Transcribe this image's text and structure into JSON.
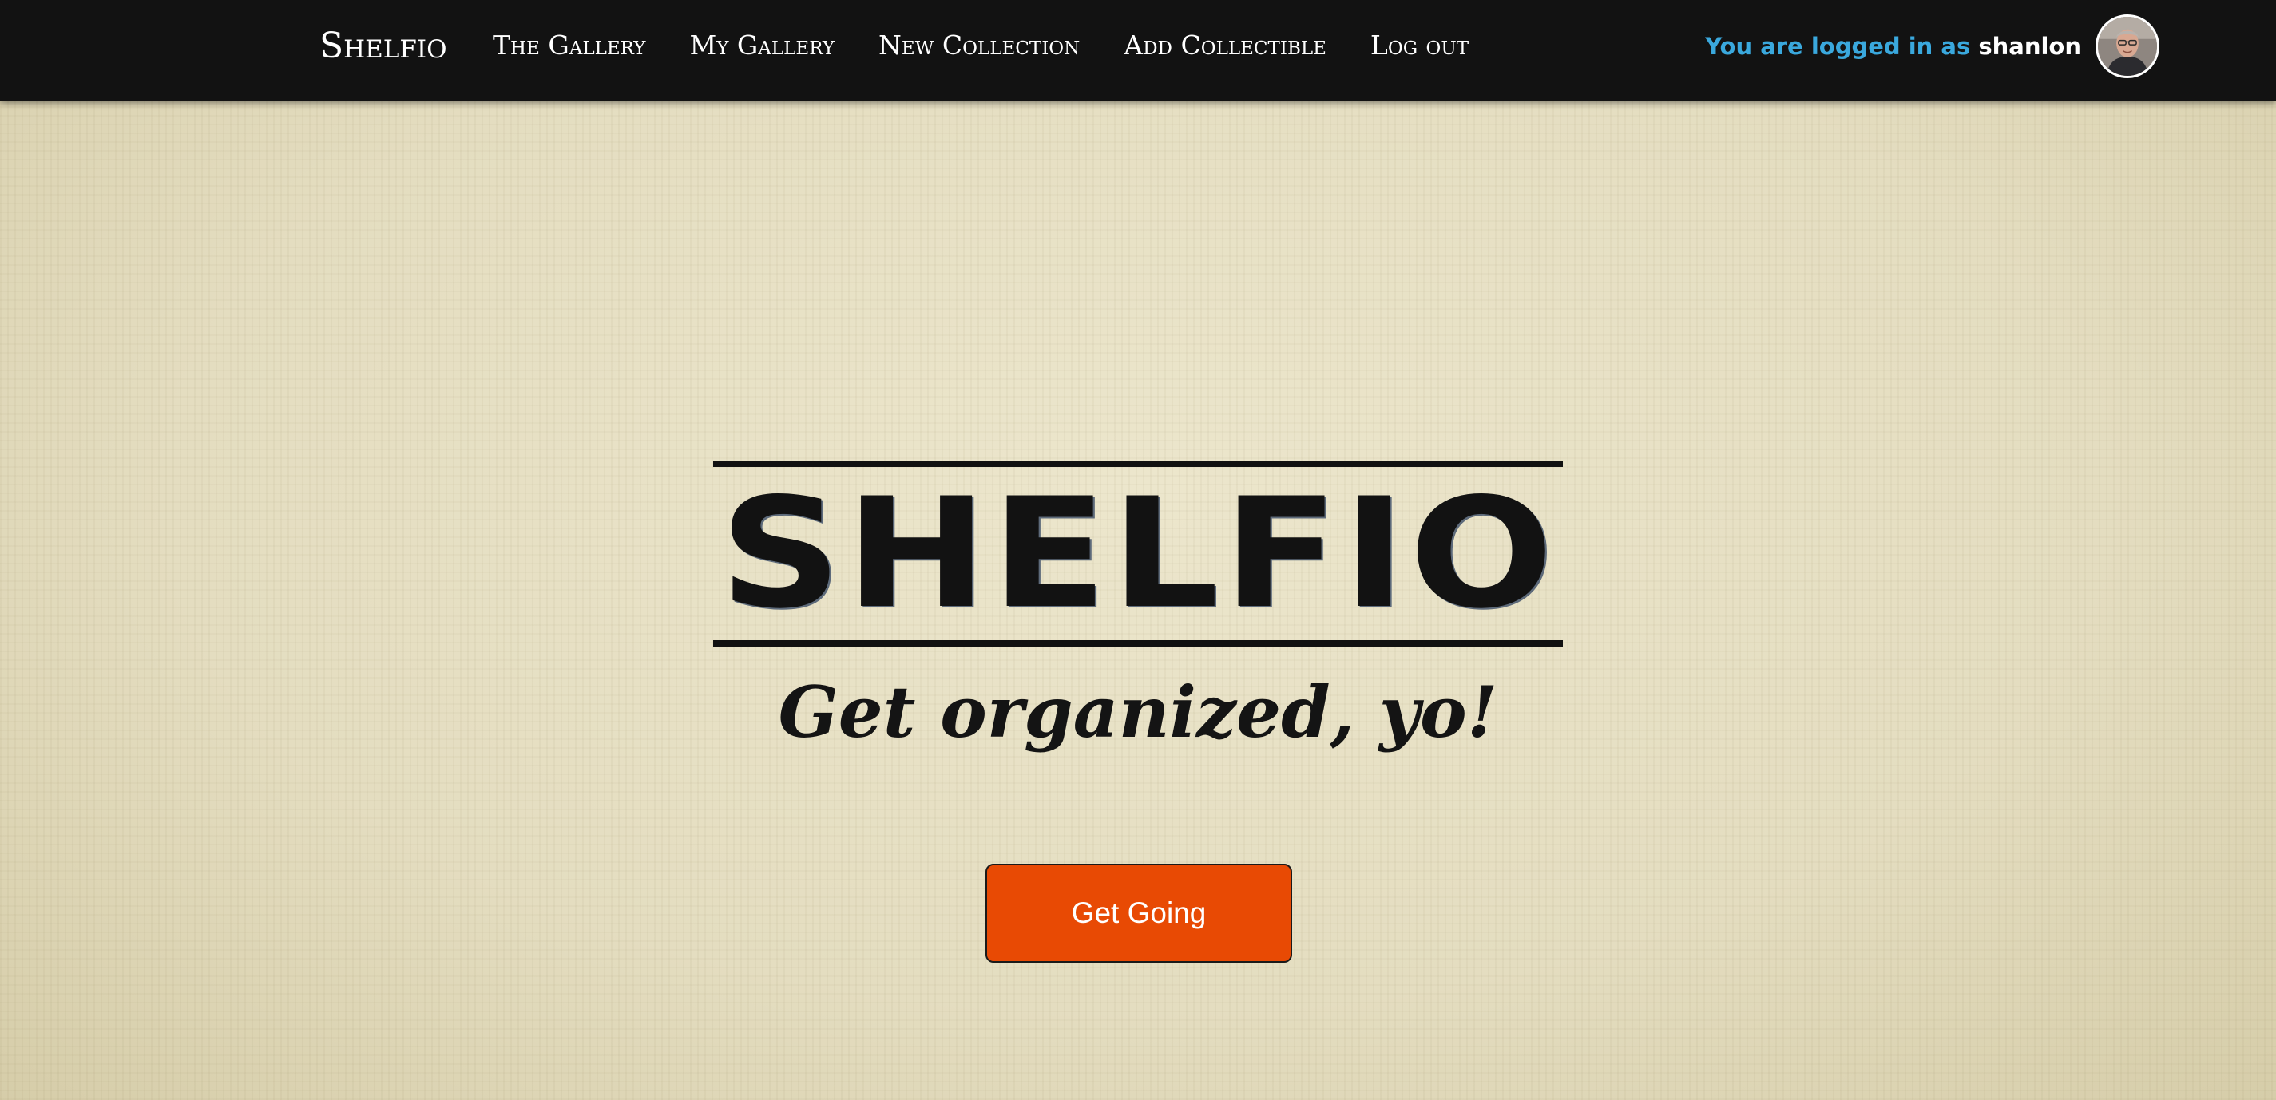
{
  "navbar": {
    "brand": "Shelfio",
    "links": [
      {
        "label": "The Gallery"
      },
      {
        "label": "My Gallery"
      },
      {
        "label": "New Collection"
      },
      {
        "label": "Add Collectible"
      },
      {
        "label": "Log out"
      }
    ],
    "login_prefix": "You are logged in as",
    "username": "shanlon",
    "avatar_icon": "user-avatar-photo"
  },
  "hero": {
    "title": "SHELFIO",
    "tagline": "Get organized, yo!",
    "cta_label": "Get Going"
  },
  "colors": {
    "navbar_bg": "#121212",
    "login_prefix": "#3aa8dd",
    "cta_bg": "#e84a04",
    "page_bg": "#e6dfc3"
  }
}
